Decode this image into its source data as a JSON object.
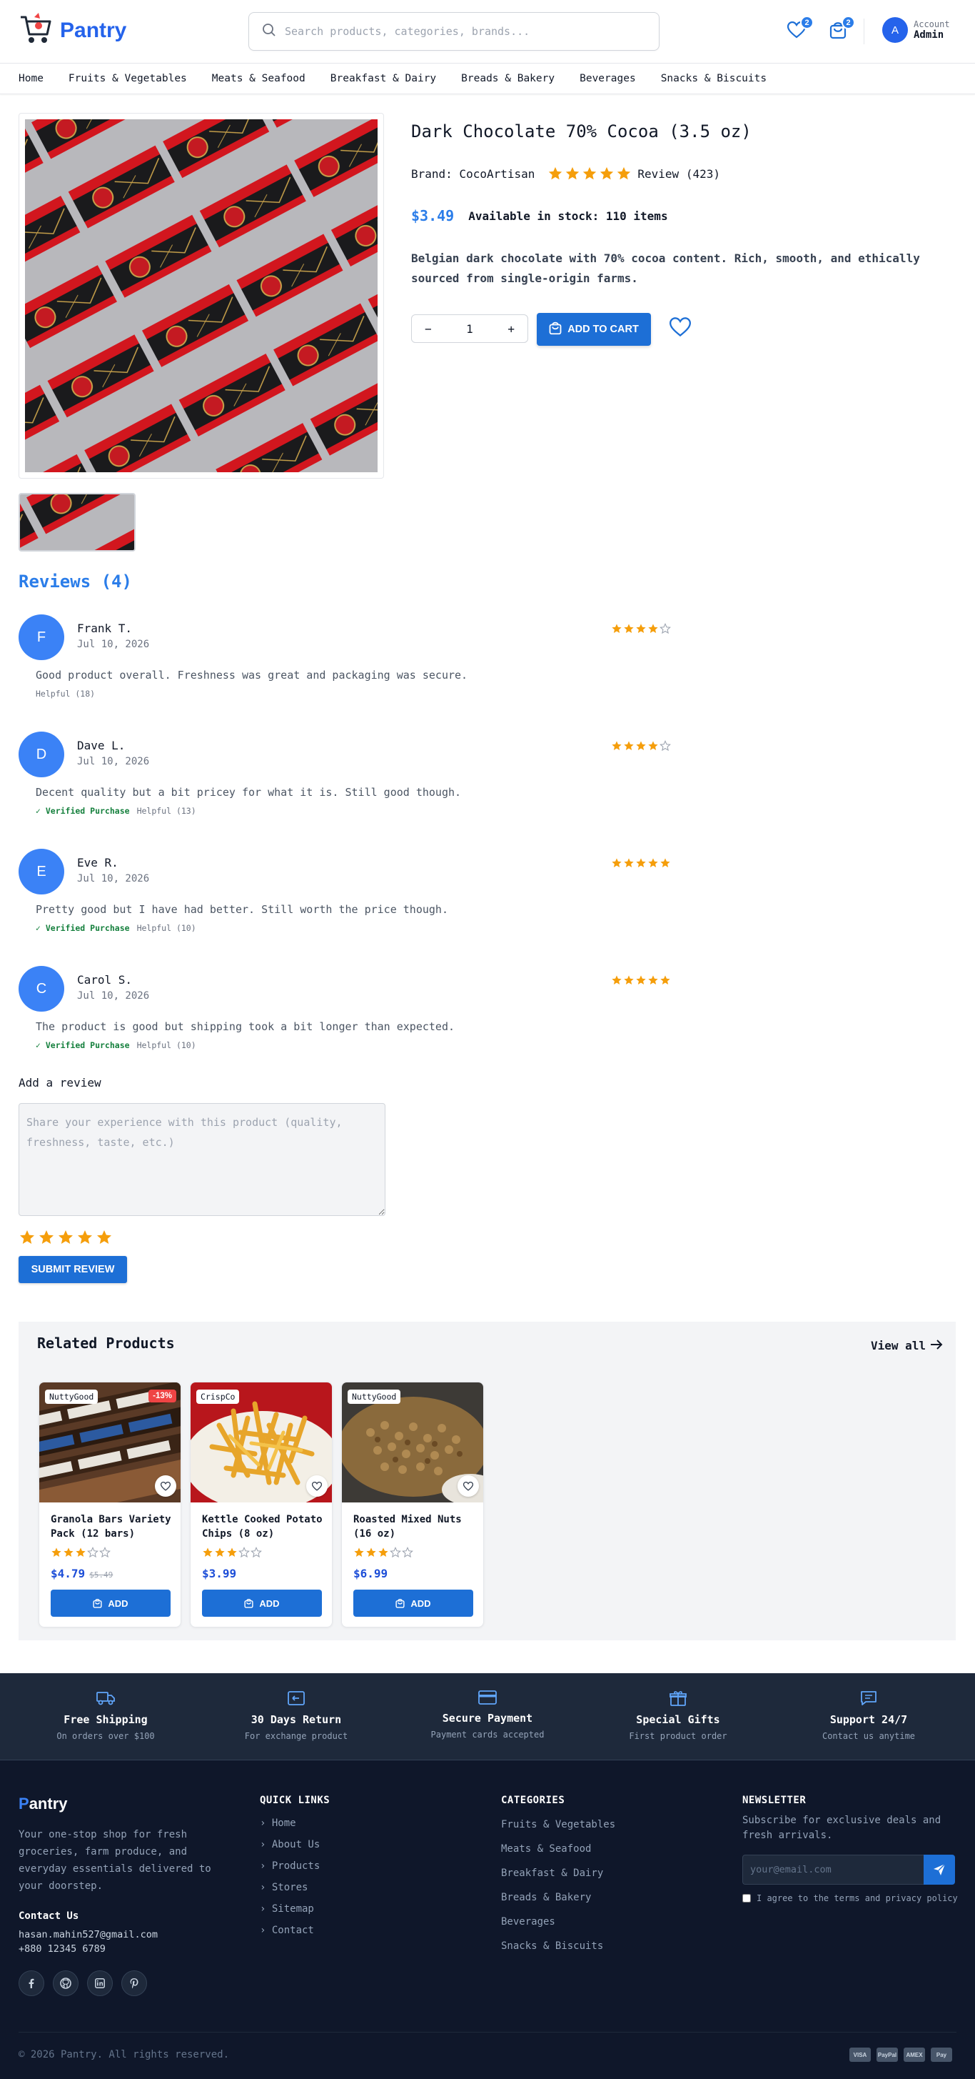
{
  "header": {
    "logo": "Pantry",
    "search_placeholder": "Search products, categories, brands...",
    "wishlist_count": "2",
    "cart_count": "2",
    "account_label": "Account",
    "account_name": "Admin",
    "avatar_letter": "A"
  },
  "nav": [
    "Home",
    "Fruits & Vegetables",
    "Meats & Seafood",
    "Breakfast & Dairy",
    "Breads & Bakery",
    "Beverages",
    "Snacks & Biscuits"
  ],
  "product": {
    "title": "Dark Chocolate 70% Cocoa (3.5 oz)",
    "brand": "Brand: CocoArtisan",
    "rating": 5,
    "review_link": "Review (423)",
    "price": "$3.49",
    "stock": "Available in stock: 110 items",
    "description": "Belgian dark chocolate with 70% cocoa content. Rich, smooth, and ethically sourced from single-origin farms.",
    "quantity": "1",
    "minus": "−",
    "plus": "+",
    "add_to_cart": "ADD TO CART"
  },
  "reviews": {
    "heading": "Reviews (4)",
    "items": [
      {
        "initial": "F",
        "name": "Frank T.",
        "date": "Jul 10, 2026",
        "stars": 4,
        "text": "Good product overall. Freshness was great and packaging was secure.",
        "verified": "",
        "helpful": "Helpful (18)"
      },
      {
        "initial": "D",
        "name": "Dave L.",
        "date": "Jul 10, 2026",
        "stars": 4,
        "text": "Decent quality but a bit pricey for what it is. Still good though.",
        "verified": "✓ Verified Purchase",
        "helpful": "Helpful (13)"
      },
      {
        "initial": "E",
        "name": "Eve R.",
        "date": "Jul 10, 2026",
        "stars": 5,
        "text": "Pretty good but I have had better. Still worth the price though.",
        "verified": "✓ Verified Purchase",
        "helpful": "Helpful (10)"
      },
      {
        "initial": "C",
        "name": "Carol S.",
        "date": "Jul 10, 2026",
        "stars": 5,
        "text": "The product is good but shipping took a bit longer than expected.",
        "verified": "✓ Verified Purchase",
        "helpful": "Helpful (10)"
      }
    ],
    "add_label": "Add a review",
    "textarea_placeholder": "Share your experience with this product (quality, freshness, taste, etc.)",
    "selected_stars": 5,
    "submit": "SUBMIT REVIEW"
  },
  "related": {
    "heading": "Related Products",
    "view_all": "View all",
    "items": [
      {
        "brand": "NuttyGood",
        "discount": "-13%",
        "name": "Granola Bars Variety Pack (12 bars)",
        "stars": 3,
        "price": "$4.79",
        "old_price": "$5.49",
        "add": "ADD"
      },
      {
        "brand": "CrispCo",
        "discount": "",
        "name": "Kettle Cooked Potato Chips (8 oz)",
        "stars": 3,
        "price": "$3.99",
        "old_price": "",
        "add": "ADD"
      },
      {
        "brand": "NuttyGood",
        "discount": "",
        "name": "Roasted Mixed Nuts (16 oz)",
        "stars": 3,
        "price": "$6.99",
        "old_price": "",
        "add": "ADD"
      }
    ]
  },
  "features": [
    {
      "icon": "truck-icon",
      "title": "Free Shipping",
      "sub": "On orders over $100"
    },
    {
      "icon": "return-icon",
      "title": "30 Days Return",
      "sub": "For exchange product"
    },
    {
      "icon": "credit-card-icon",
      "title": "Secure Payment",
      "sub": "Payment cards accepted"
    },
    {
      "icon": "gift-icon",
      "title": "Special Gifts",
      "sub": "First product order"
    },
    {
      "icon": "chat-icon",
      "title": "Support 24/7",
      "sub": "Contact us anytime"
    }
  ],
  "footer": {
    "brand_first": "P",
    "brand_rest": "antry",
    "description": "Your one-stop shop for fresh groceries, farm produce, and everyday essentials delivered to your doorstep.",
    "contact_title": "Contact Us",
    "email": "hasan.mahin527@gmail.com",
    "phone": "+880 12345 6789",
    "quick_links_title": "QUICK LINKS",
    "quick_links": [
      "Home",
      "About Us",
      "Products",
      "Stores",
      "Sitemap",
      "Contact"
    ],
    "categories_title": "CATEGORIES",
    "categories": [
      "Fruits & Vegetables",
      "Meats & Seafood",
      "Breakfast & Dairy",
      "Breads & Bakery",
      "Beverages",
      "Snacks & Biscuits"
    ],
    "newsletter_title": "NEWSLETTER",
    "newsletter_sub": "Subscribe for exclusive deals and fresh arrivals.",
    "email_placeholder": "your@email.com",
    "agree": "I agree to the terms and privacy policy",
    "copyright": "© 2026 Pantry. All rights reserved.",
    "payments": [
      "VISA",
      "PayPal",
      "AMEX",
      "Pay"
    ]
  },
  "colors": {
    "accent": "#2b7de9",
    "button": "#1d6fd6",
    "star": "#f59e0b",
    "footer_bg": "#0f172a",
    "band_bg": "#1e293b"
  }
}
